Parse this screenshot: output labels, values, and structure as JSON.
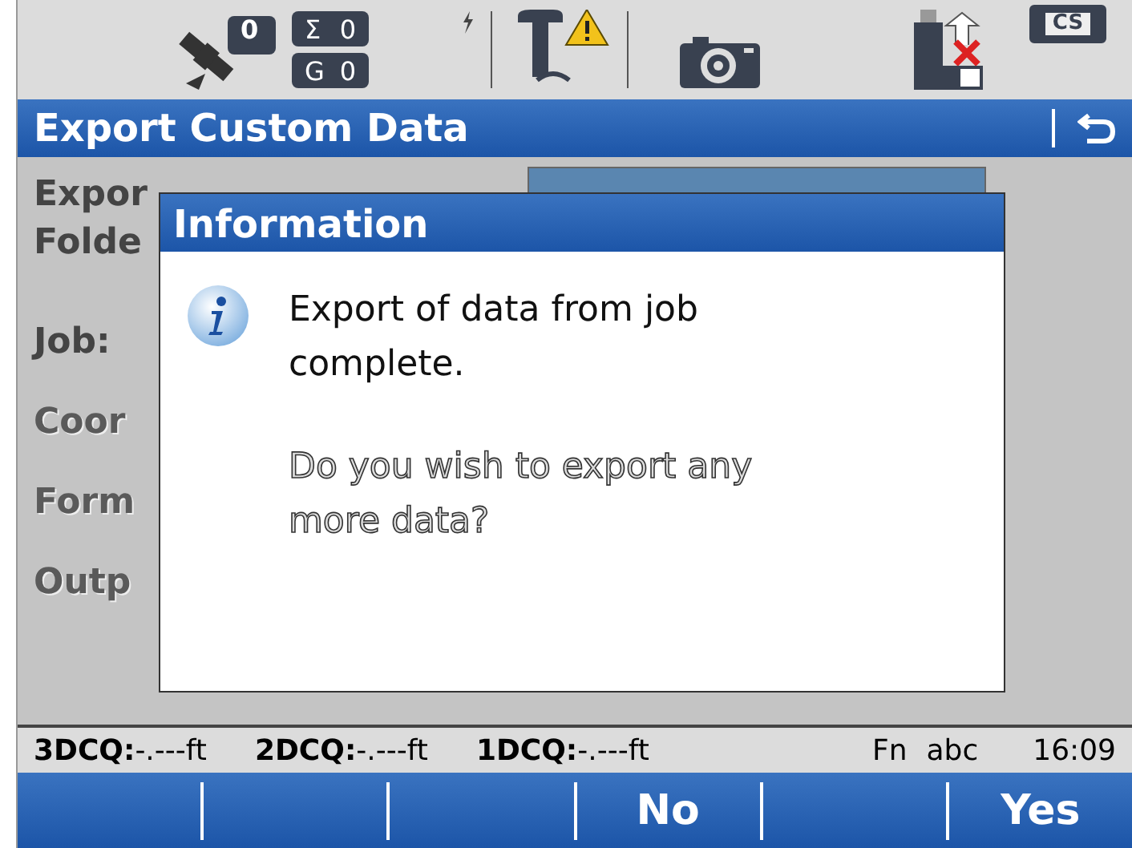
{
  "status_icons": {
    "satellites": "0",
    "sigma_label": "Σ",
    "sigma_count": "0",
    "g_label": "G",
    "g_count": "0",
    "battery_label": "CS"
  },
  "title": "Export Custom Data",
  "form_labels": [
    {
      "text": "Expor",
      "kind": "plain"
    },
    {
      "text": "Folde",
      "kind": "plain"
    },
    {
      "text": "Job:",
      "kind": "plain"
    },
    {
      "text": "Coor",
      "kind": "outlined"
    },
    {
      "text": "Form",
      "kind": "outlined"
    },
    {
      "text": "Outp",
      "kind": "outlined"
    }
  ],
  "dialog": {
    "title": "Information",
    "message": "Export of data from job complete.",
    "question": "Do you wish to export any more data?"
  },
  "status_line": [
    {
      "label": "3DCQ:",
      "value": "-.---ft"
    },
    {
      "label": "2DCQ:",
      "value": "-.---ft"
    },
    {
      "label": "1DCQ:",
      "value": "-.---ft"
    }
  ],
  "mode": [
    "Fn",
    "abc"
  ],
  "time": "16:09",
  "softkeys": [
    "No",
    "Yes"
  ]
}
